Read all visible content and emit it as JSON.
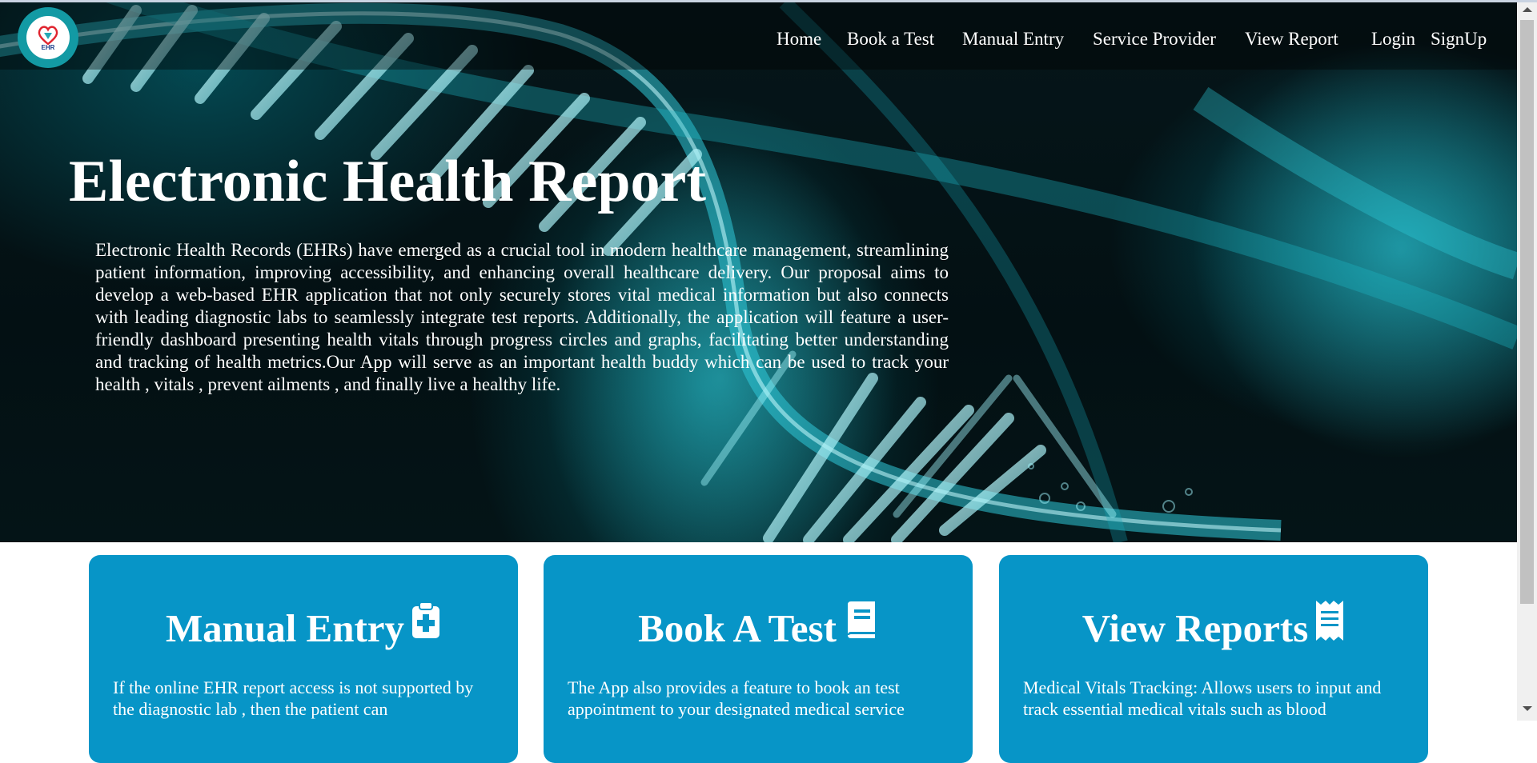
{
  "app": {
    "logo_text": "EHR"
  },
  "nav": {
    "items": [
      {
        "label": "Home"
      },
      {
        "label": "Book a Test"
      },
      {
        "label": "Manual Entry"
      },
      {
        "label": "Service Provider"
      },
      {
        "label": "View Report"
      },
      {
        "label": "Login"
      },
      {
        "label": "SignUp"
      }
    ]
  },
  "hero": {
    "title": "Electronic Health Report",
    "description": "Electronic Health Records (EHRs) have emerged as a crucial tool in modern healthcare management, streamlining patient information, improving accessibility, and enhancing overall healthcare delivery. Our proposal aims to develop a web-based EHR application that not only securely stores vital medical information but also connects with leading diagnostic labs to seamlessly integrate test reports. Additionally, the application will feature a user-friendly dashboard presenting health vitals through progress circles and graphs, facilitating better understanding and tracking of health metrics.Our App will serve as an important health buddy which can be used to track your health , vitals , prevent ailments , and finally live a healthy life."
  },
  "cards": [
    {
      "title": "Manual Entry",
      "icon": "clipboard-plus-icon",
      "body": "If the online EHR report access is not supported by the diagnostic lab , then the patient can"
    },
    {
      "title": "Book A Test",
      "icon": "book-icon",
      "body": "The App also provides a feature to book an test appointment to your designated medical service"
    },
    {
      "title": "View Reports",
      "icon": "receipt-icon",
      "body": "Medical Vitals Tracking: Allows users to input and track essential medical vitals such as blood"
    }
  ],
  "colors": {
    "card_bg": "#0795c7",
    "logo_ring": "#139aa4",
    "hero_bg": "#031013",
    "dna_cyan": "#35d6e6"
  }
}
